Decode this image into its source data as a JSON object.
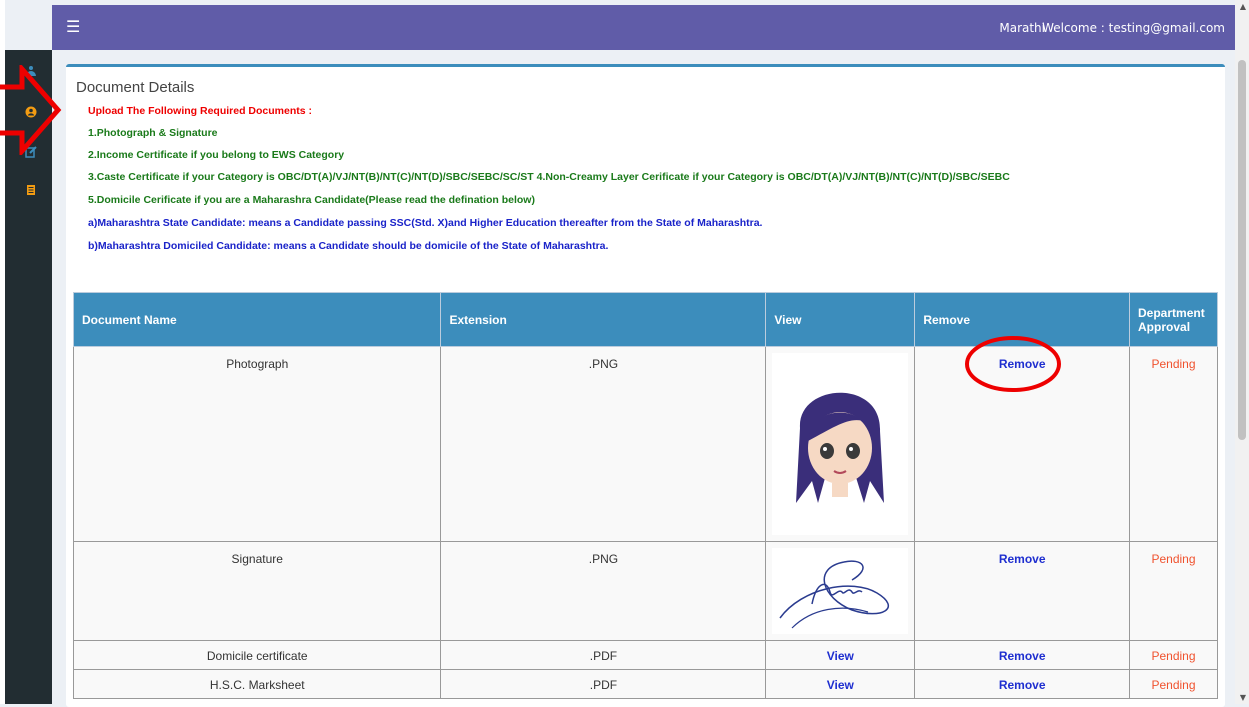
{
  "header": {
    "language": "Marathi",
    "welcome": "Welcome : testing@gmail.com"
  },
  "icons": {
    "menu": "hamburger-icon",
    "sidebar": [
      "dashboard-icon",
      "user-icon",
      "edit-icon",
      "document-icon"
    ]
  },
  "colors": {
    "topbar": "#605ca8",
    "sidebar": "#222d32",
    "table_header": "#3c8dbc",
    "required_red": "#e00000",
    "green_text": "#1a7a1a",
    "blue_text": "#1a23c9",
    "pending": "#f0522e"
  },
  "box": {
    "title": "Document Details",
    "lines": [
      "Upload The Following Required Documents :",
      "1.Photograph & Signature",
      "2.Income Certificate if you belong to EWS Category",
      "3.Caste Certificate if your Category is OBC/DT(A)/VJ/NT(B)/NT(C)/NT(D)/SBC/SEBC/SC/ST 4.Non-Creamy Layer Cerificate if your Category is OBC/DT(A)/VJ/NT(B)/NT(C)/NT(D)/SBC/SEBC",
      "5.Domicile Cerificate if you are a Maharashra Candidate(Please read the defination below)",
      "a)Maharashtra State Candidate: means a Candidate passing SSC(Std. X)and Higher Education thereafter from the State of Maharashtra.",
      "b)Maharashtra Domiciled Candidate: means a Candidate should be domicile of the State of Maharashtra."
    ]
  },
  "table": {
    "headers": [
      "Document Name",
      "Extension",
      "View",
      "Remove",
      "Department Approval"
    ],
    "rows": [
      {
        "name": "Photograph",
        "ext": ".PNG",
        "view": "",
        "remove": "Remove",
        "status": "Pending"
      },
      {
        "name": "Signature",
        "ext": ".PNG",
        "view": "",
        "remove": "Remove",
        "status": "Pending"
      },
      {
        "name": "Domicile certificate",
        "ext": ".PDF",
        "view": "View",
        "remove": "Remove",
        "status": "Pending"
      },
      {
        "name": "H.S.C. Marksheet",
        "ext": ".PDF",
        "view": "View",
        "remove": "Remove",
        "status": "Pending"
      }
    ]
  }
}
